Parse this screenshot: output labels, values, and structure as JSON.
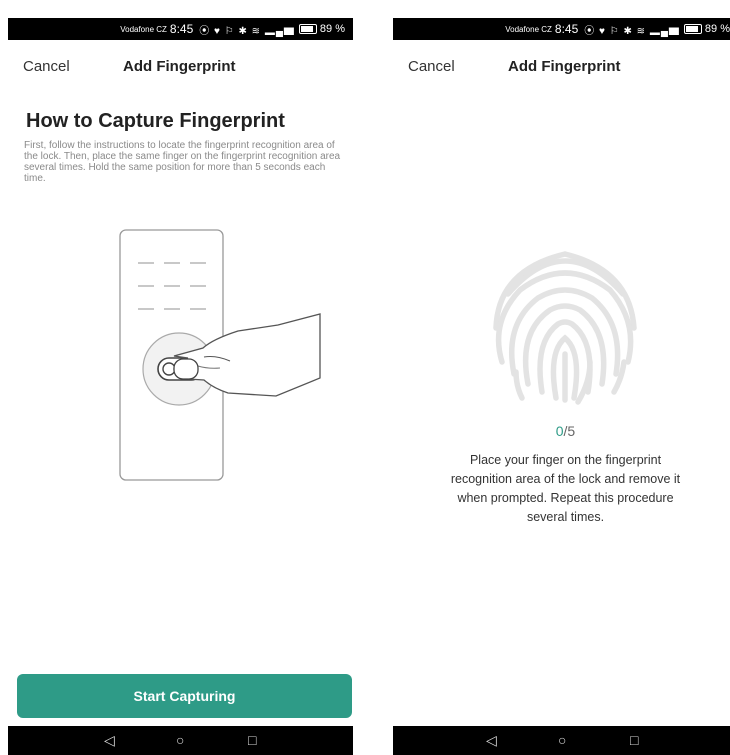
{
  "status": {
    "carrier": "Vodafone CZ",
    "time": "8:45",
    "icons": "⦿ ♥  ⚐ ✱ ≋ ▂▄▆",
    "battery": "89 %"
  },
  "left_screen": {
    "cancel_label": "Cancel",
    "title": "Add Fingerprint",
    "heading": "How to Capture Fingerprint",
    "description": "First, follow the instructions to locate the fingerprint recognition area of the lock. Then, place the same finger on the fingerprint recognition area several times. Hold the same position for more than 5 seconds each time.",
    "button_label": "Start Capturing"
  },
  "right_screen": {
    "cancel_label": "Cancel",
    "title": "Add Fingerprint",
    "progress_current": "0",
    "progress_total": "/5",
    "instruction": "Place your finger on the fingerprint recognition area of the lock and remove it when prompted. Repeat this procedure several times."
  },
  "system_nav": {
    "back": "◁",
    "home": "○",
    "recents": "□"
  },
  "colors": {
    "accent": "#2e9b87",
    "text_secondary": "#8a8a8a",
    "fingerprint": "#e3e3e3"
  },
  "icons": [
    "back-triangle-icon",
    "home-circle-icon",
    "recents-square-icon",
    "fingerprint-icon",
    "door-lock-illustration"
  ]
}
